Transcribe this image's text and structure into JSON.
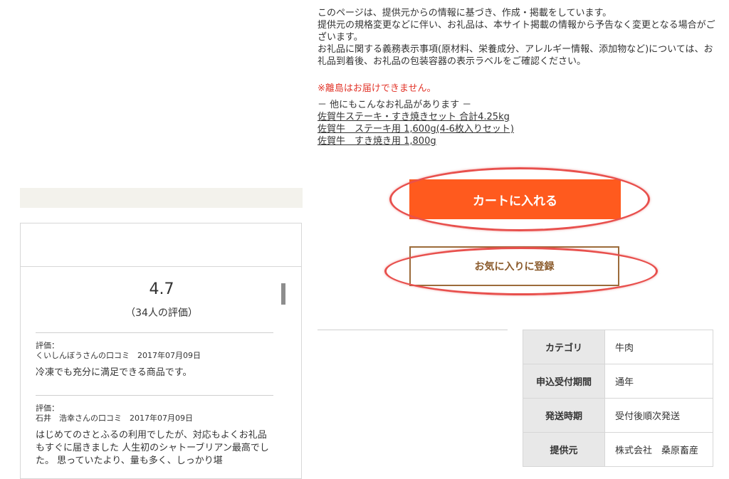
{
  "notice": {
    "line1": "このページは、提供元からの情報に基づき、作成・掲載をしています。",
    "line2": "提供元の規格変更などに伴い、お礼品は、本サイト掲載の情報から予告なく変更となる場合がございます。",
    "line3": "お礼品に関する義務表示事項(原材料、栄養成分、アレルギー情報、添加物など)については、お礼品到着後、お礼品の包装容器の表示ラベルをご確認ください。"
  },
  "warning": "※離島はお届けできません。",
  "related": {
    "heading": "－ 他にもこんなお礼品があります －",
    "links": [
      "佐賀牛ステーキ・すき焼きセット 合計4.25kg",
      "佐賀牛　ステーキ用 1,600g(4-6枚入りセット)",
      "佐賀牛　すき焼き用 1,800g"
    ]
  },
  "buttons": {
    "cart": "カートに入れる",
    "favorite": "お気に入りに登録"
  },
  "colors": {
    "cart_bg": "#ff5a1e",
    "favorite_border": "#9c6b3a",
    "annotation": "#e8504d",
    "warning": "#e2352a"
  },
  "reviews": {
    "score": "4.7",
    "count": "（34人の評価）",
    "items": [
      {
        "label": "評価：",
        "meta": "くいしんぼうさんの口コミ　2017年07月09日",
        "body": "冷凍でも充分に満足できる商品です。"
      },
      {
        "label": "評価：",
        "meta": "石井　浩幸さんの口コミ　2017年07月09日",
        "body": "はじめてのさとふるの利用でしたが、対応もよくお礼品もすぐに届きました 人生初のシャトーブリアン最高でした。 思っていたより、量も多く、しっかり堪"
      }
    ]
  },
  "info": [
    {
      "key": "カテゴリ",
      "value": "牛肉"
    },
    {
      "key": "申込受付期間",
      "value": "通年"
    },
    {
      "key": "発送時期",
      "value": "受付後順次発送"
    },
    {
      "key": "提供元",
      "value": "株式会社　桑原畜産"
    }
  ]
}
